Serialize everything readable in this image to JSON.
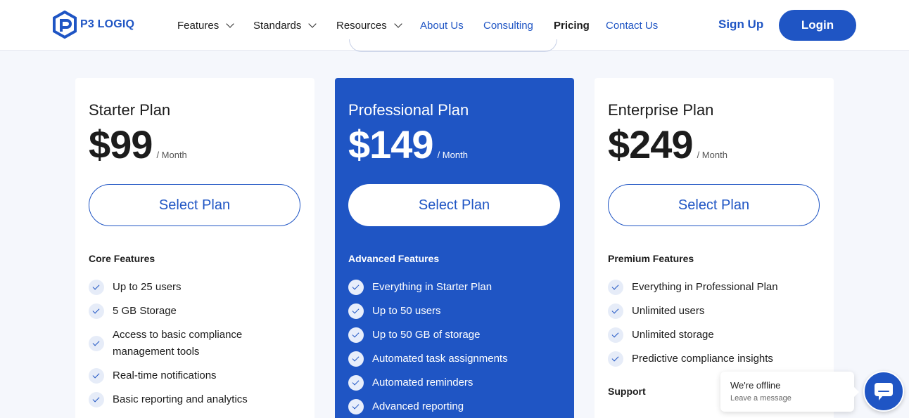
{
  "brand": {
    "name": "P3 LOGIQ",
    "color": "#1f55c4"
  },
  "nav": {
    "features": "Features",
    "standards": "Standards",
    "resources": "Resources",
    "about": "About Us",
    "consulting": "Consulting",
    "pricing": "Pricing",
    "contact": "Contact Us",
    "signup": "Sign Up",
    "login": "Login"
  },
  "plans": [
    {
      "name": "Starter Plan",
      "price": "$99",
      "period": "/ Month",
      "button": "Select Plan",
      "section": "Core Features",
      "features": [
        "Up to 25 users",
        "5 GB Storage",
        "Access to basic compliance management tools",
        "Real-time notifications",
        "Basic reporting and analytics"
      ]
    },
    {
      "name": "Professional Plan",
      "price": "$149",
      "period": "/ Month",
      "button": "Select Plan",
      "section": "Advanced Features",
      "features": [
        "Everything in Starter Plan",
        "Up to 50 users",
        "Up to 50 GB of storage",
        "Automated task assignments",
        "Automated reminders",
        "Advanced reporting"
      ]
    },
    {
      "name": "Enterprise Plan",
      "price": "$249",
      "period": "/ Month",
      "button": "Select Plan",
      "section": "Premium Features",
      "features": [
        "Everything in Professional Plan",
        "Unlimited users",
        "Unlimited storage",
        "Predictive compliance insights"
      ],
      "support": "Support"
    }
  ],
  "chat": {
    "title": "We're offline",
    "subtitle": "Leave a message"
  }
}
